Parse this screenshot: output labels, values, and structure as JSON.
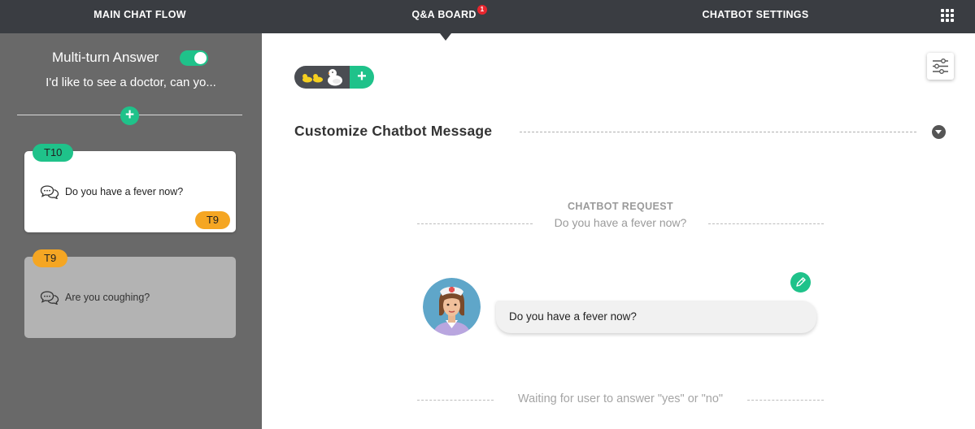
{
  "nav": {
    "tabs": [
      "MAIN CHAT FLOW",
      "Q&A BOARD",
      "CHATBOT SETTINGS"
    ],
    "active_tab": "Q&A BOARD",
    "qa_badge": "1",
    "apps_icon": "grid-icon"
  },
  "sidebar": {
    "multi_turn_label": "Multi-turn Answer",
    "multi_turn_enabled": true,
    "question_preview": "I'd like to see a doctor, can yo...",
    "cards": [
      {
        "tag": "T10",
        "text": "Do you have a fever now?",
        "next_tag": "T9",
        "selected": true
      },
      {
        "tag": "T9",
        "text": "Are you coughing?",
        "selected": false
      }
    ]
  },
  "main": {
    "section_title": "Customize Chatbot Message",
    "request_title": "CHATBOT REQUEST",
    "request_text": "Do you have a fever now?",
    "bubble_text": "Do you have a fever now?",
    "waiting_text": "Waiting for user to answer \"yes\" or \"no\""
  },
  "colors": {
    "nav_bg": "#3a3d42",
    "sidebar_bg": "#696969",
    "accent_green": "#1fc28a",
    "tag_orange": "#f5a623",
    "badge_red": "#e8262e"
  }
}
